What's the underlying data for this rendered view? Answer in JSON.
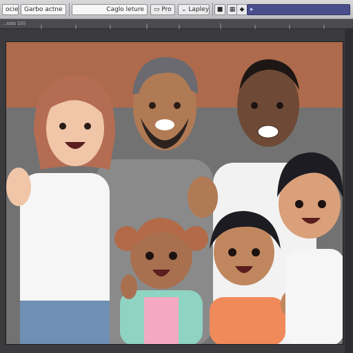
{
  "toolbar": {
    "field1": "ocie",
    "field2": "Garbo actne",
    "field3": "Caglo leture",
    "field4": "Pro",
    "field5": "Lapley"
  },
  "ruler": {
    "label": "...osis 10)"
  },
  "colors": {
    "wall_top": "#b06a4a",
    "wall_bottom": "#707070",
    "accent": "#4a4f8c"
  }
}
